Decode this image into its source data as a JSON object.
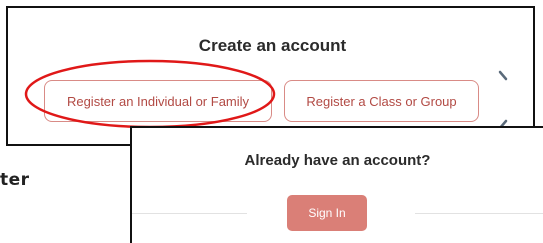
{
  "create_account": {
    "title": "Create an account",
    "register_individual_label": "Register an Individual or Family",
    "register_class_label": "Register a Class or Group"
  },
  "background_fragment": {
    "text": "ter"
  },
  "sign_in": {
    "title": "Already have an account?",
    "button_label": "Sign In"
  },
  "colors": {
    "outline_button_border": "#d98b86",
    "outline_button_text": "#b24a44",
    "sign_in_button_bg": "#da7f77",
    "annotation_red": "#e01818",
    "panel_border": "#111111"
  },
  "icons": {
    "carousel_next": "chevron-right-icon"
  }
}
